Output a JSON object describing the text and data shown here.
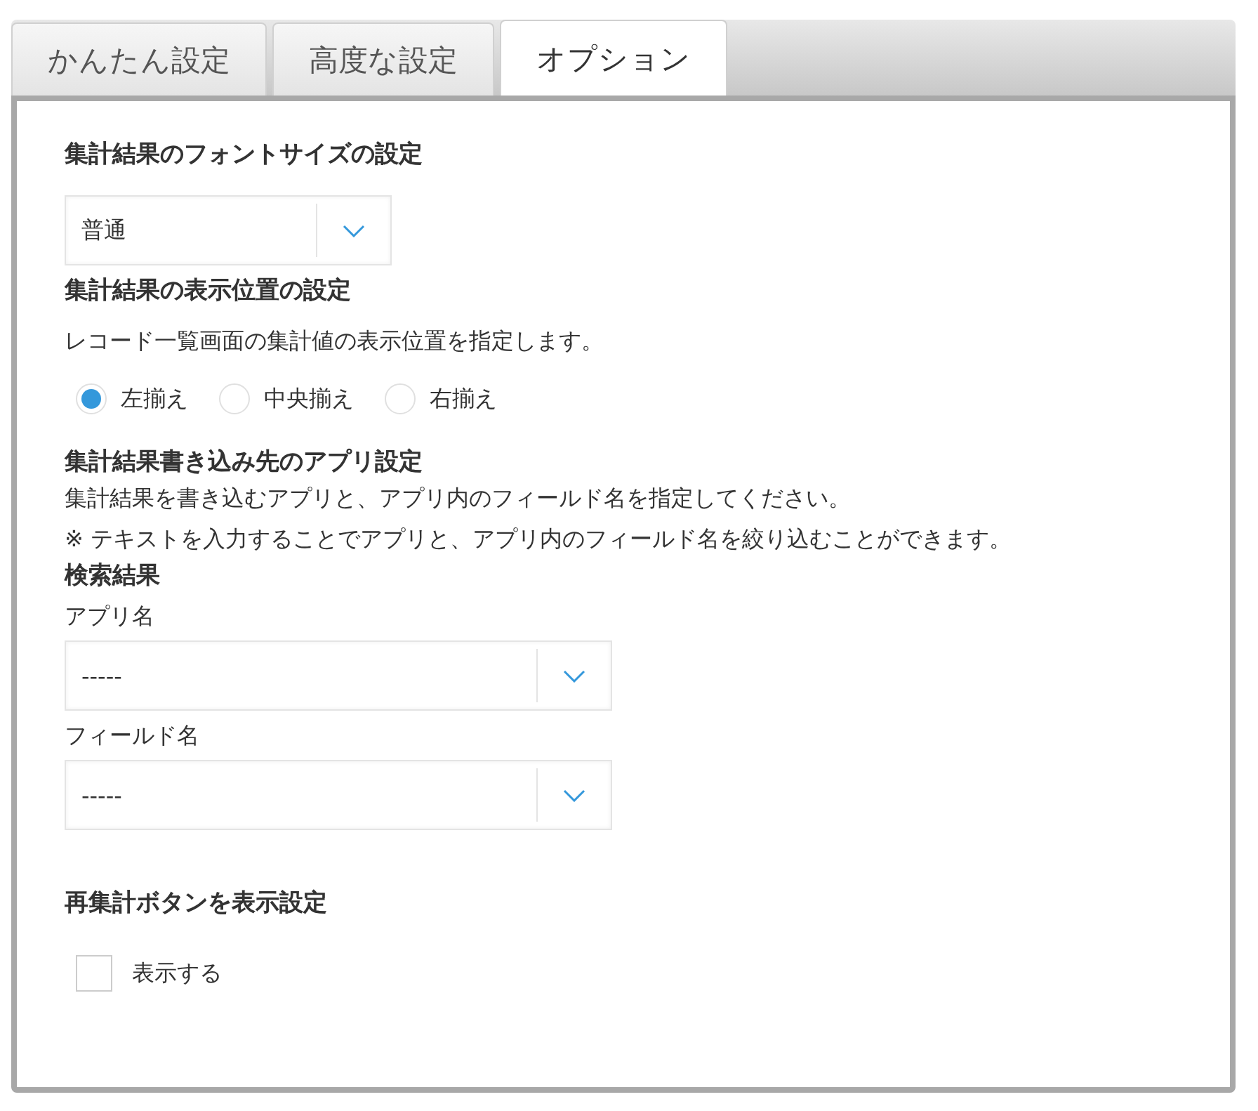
{
  "tabs": [
    {
      "label": "かんたん設定",
      "selected": false
    },
    {
      "label": "高度な設定",
      "selected": false
    },
    {
      "label": "オプション",
      "selected": true
    }
  ],
  "font_size_section": {
    "heading": "集計結果のフォントサイズの設定",
    "select": {
      "value": "普通"
    }
  },
  "position_section": {
    "heading": "集計結果の表示位置の設定",
    "description": "レコード一覧画面の集計値の表示位置を指定します。",
    "radios": [
      {
        "label": "左揃え",
        "selected": true
      },
      {
        "label": "中央揃え",
        "selected": false
      },
      {
        "label": "右揃え",
        "selected": false
      }
    ]
  },
  "target_section": {
    "heading": "集計結果書き込み先のアプリ設定",
    "descriptions": [
      "集計結果を書き込むアプリと、アプリ内のフィールド名を指定してください。",
      "※ テキストを入力することでアプリと、アプリ内のフィールド名を絞り込むことができます。"
    ],
    "results_heading": "検索結果",
    "fields": [
      {
        "label": "アプリ名",
        "value": "-----"
      },
      {
        "label": "フィールド名",
        "value": "-----"
      }
    ]
  },
  "recalc_section": {
    "heading": "再集計ボタンを表示設定",
    "checkbox": {
      "label": "表示する",
      "checked": false
    }
  }
}
